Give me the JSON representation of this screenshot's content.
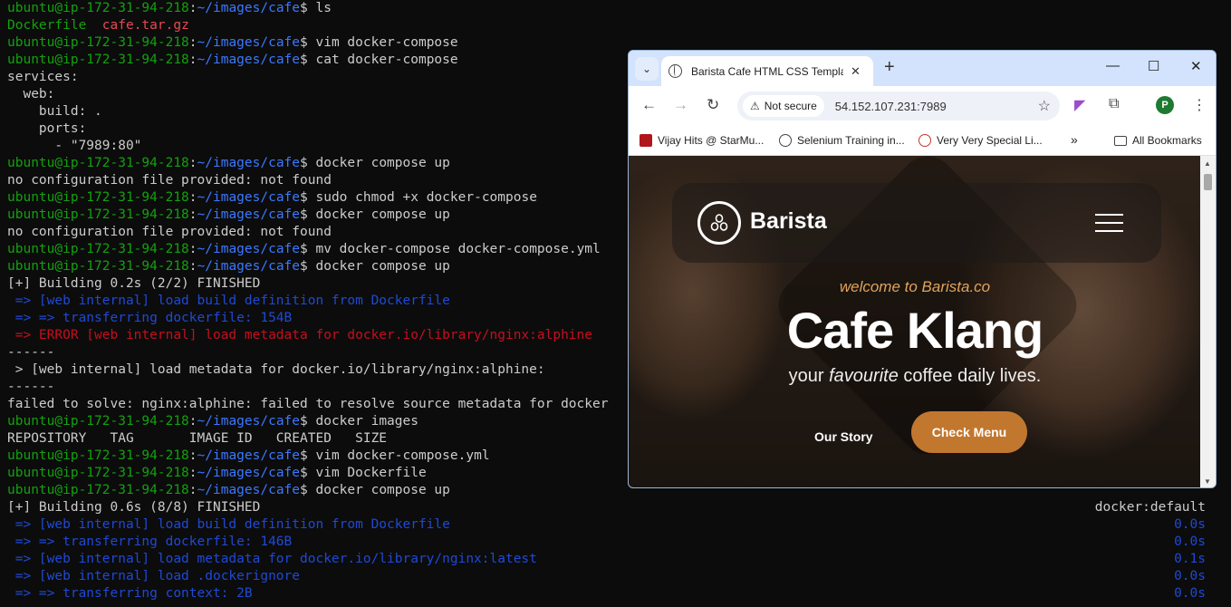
{
  "terminal": {
    "prompt_user": "ubuntu@ip-172-31-94-218",
    "prompt_path": "~/images/cafe",
    "lines": [
      {
        "kind": "cmd",
        "cmd": "ls"
      },
      {
        "kind": "ls",
        "a": "Dockerfile",
        "b": "cafe.tar.gz"
      },
      {
        "kind": "cmd",
        "cmd": "vim docker-compose"
      },
      {
        "kind": "cmd",
        "cmd": "cat docker-compose"
      },
      {
        "kind": "out",
        "text": "services:"
      },
      {
        "kind": "out",
        "text": "  web:"
      },
      {
        "kind": "out",
        "text": "    build: ."
      },
      {
        "kind": "out",
        "text": "    ports:"
      },
      {
        "kind": "out",
        "text": "      - \"7989:80\""
      },
      {
        "kind": "cmd",
        "cmd": "docker compose up"
      },
      {
        "kind": "out",
        "text": "no configuration file provided: not found"
      },
      {
        "kind": "cmd",
        "cmd": "sudo chmod +x docker-compose"
      },
      {
        "kind": "cmd",
        "cmd": "docker compose up"
      },
      {
        "kind": "out",
        "text": "no configuration file provided: not found"
      },
      {
        "kind": "cmd",
        "cmd": "mv docker-compose docker-compose.yml"
      },
      {
        "kind": "cmd",
        "cmd": "docker compose up"
      },
      {
        "kind": "out",
        "text": "[+] Building 0.2s (2/2) FINISHED"
      },
      {
        "kind": "blue",
        "text": " => [web internal] load build definition from Dockerfile"
      },
      {
        "kind": "blue",
        "text": " => => transferring dockerfile: 154B"
      },
      {
        "kind": "err",
        "text": " => ERROR [web internal] load metadata for docker.io/library/nginx:alphine"
      },
      {
        "kind": "out",
        "text": "------"
      },
      {
        "kind": "out",
        "text": " > [web internal] load metadata for docker.io/library/nginx:alphine:"
      },
      {
        "kind": "out",
        "text": "------"
      },
      {
        "kind": "out",
        "text": "failed to solve: nginx:alphine: failed to resolve source metadata for docker"
      },
      {
        "kind": "cmd",
        "cmd": "docker images"
      },
      {
        "kind": "out",
        "text": "REPOSITORY   TAG       IMAGE ID   CREATED   SIZE"
      },
      {
        "kind": "cmd",
        "cmd": "vim docker-compose.yml"
      },
      {
        "kind": "cmd",
        "cmd": "vim Dockerfile"
      },
      {
        "kind": "cmd",
        "cmd": "docker compose up"
      },
      {
        "kind": "out",
        "text": "[+] Building 0.6s (8/8) FINISHED"
      },
      {
        "kind": "blue",
        "text": " => [web internal] load build definition from Dockerfile"
      },
      {
        "kind": "blue",
        "text": " => => transferring dockerfile: 146B"
      },
      {
        "kind": "blue",
        "text": " => [web internal] load metadata for docker.io/library/nginx:latest"
      },
      {
        "kind": "blue",
        "text": " => [web internal] load .dockerignore"
      },
      {
        "kind": "blue",
        "text": " => => transferring context: 2B"
      }
    ],
    "right_col": [
      {
        "row": 29,
        "text": "docker:default",
        "color": "#cccccc"
      },
      {
        "row": 30,
        "text": "0.0s",
        "color": "#1f49d6"
      },
      {
        "row": 31,
        "text": "0.0s",
        "color": "#1f49d6"
      },
      {
        "row": 32,
        "text": "0.1s",
        "color": "#1f49d6"
      },
      {
        "row": 33,
        "text": "0.0s",
        "color": "#1f49d6"
      },
      {
        "row": 34,
        "text": "0.0s",
        "color": "#1f49d6"
      }
    ]
  },
  "browser": {
    "tab_title": "Barista Cafe HTML CSS Template",
    "security_label": "Not secure",
    "url": "54.152.107.231:7989",
    "profile_initial": "P",
    "bookmarks": [
      {
        "label": "Vijay Hits @ StarMu...",
        "icon": "red-icon"
      },
      {
        "label": "Selenium Training in...",
        "icon": "globe-icon"
      },
      {
        "label": "Very Very Special Li...",
        "icon": "w-icon"
      }
    ],
    "all_bookmarks": "All Bookmarks"
  },
  "site": {
    "logo_text": "Barista",
    "welcome": "welcome to Barista.co",
    "title": "Cafe Klang",
    "subtitle_pre": "your ",
    "subtitle_em": "favourite",
    "subtitle_post": " coffee daily lives.",
    "our_story": "Our Story",
    "check_menu": "Check Menu"
  },
  "colors": {
    "prompt_user": "#13a10e",
    "prompt_path": "#3b78ff",
    "accent_button": "#c2772f"
  }
}
